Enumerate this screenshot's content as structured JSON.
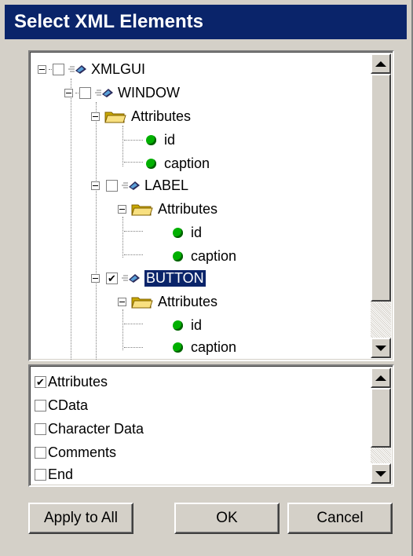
{
  "window": {
    "title": "Select XML Elements"
  },
  "tree": {
    "nodes": [
      {
        "label": "XMLGUI",
        "kind": "element",
        "checked": false
      },
      {
        "label": "WINDOW",
        "kind": "element",
        "checked": false
      },
      {
        "label": "Attributes",
        "kind": "folder"
      },
      {
        "label": "id",
        "kind": "attribute"
      },
      {
        "label": "caption",
        "kind": "attribute"
      },
      {
        "label": "LABEL",
        "kind": "element",
        "checked": false
      },
      {
        "label": "Attributes",
        "kind": "folder"
      },
      {
        "label": "id",
        "kind": "attribute"
      },
      {
        "label": "caption",
        "kind": "attribute"
      },
      {
        "label": "BUTTON",
        "kind": "element",
        "checked": true,
        "selected": true
      },
      {
        "label": "Attributes",
        "kind": "folder"
      },
      {
        "label": "id",
        "kind": "attribute"
      },
      {
        "label": "caption",
        "kind": "attribute"
      }
    ]
  },
  "options": [
    {
      "label": "Attributes",
      "checked": true
    },
    {
      "label": "CData",
      "checked": false
    },
    {
      "label": "Character Data",
      "checked": false
    },
    {
      "label": "Comments",
      "checked": false
    },
    {
      "label": "End",
      "checked": false
    }
  ],
  "buttons": {
    "apply_all": "Apply to All",
    "ok": "OK",
    "cancel": "Cancel"
  },
  "colors": {
    "title_bg": "#0a246a",
    "face": "#d4d0c8",
    "dot": "#00b000",
    "selection": "#0a246a"
  },
  "icons": {
    "element": "element-icon",
    "folder": "folder-icon",
    "attribute": "attribute-dot-icon"
  }
}
